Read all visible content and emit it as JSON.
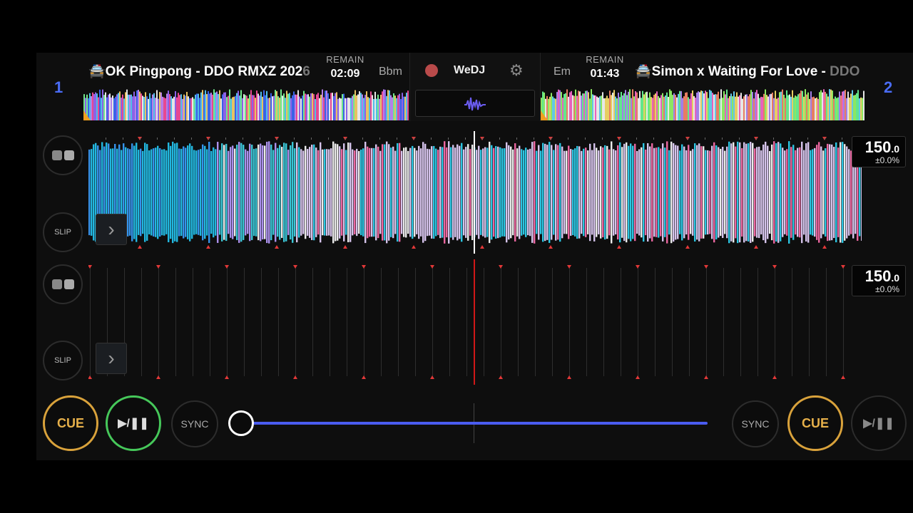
{
  "deck1": {
    "number": "1",
    "title_main": "OK Pingpong - DDO RMXZ 202",
    "title_fade": "6",
    "remain_label": "REMAIN",
    "remain_time": "02:09",
    "key": "Bbm",
    "bpm_int": "150",
    "bpm_dec": ".0",
    "pitch": "±0.0%",
    "slip_label": "SLIP",
    "cue_label": "CUE",
    "play_label": "▶/❚❚",
    "sync_label": "SYNC"
  },
  "deck2": {
    "number": "2",
    "title_main": "Simon x Waiting For Love - ",
    "title_fade": "DDO",
    "remain_label": "REMAIN",
    "remain_time": "01:43",
    "key": "Em",
    "bpm_int": "150",
    "bpm_dec": ".0",
    "pitch": "±0.0%",
    "slip_label": "SLIP",
    "cue_label": "CUE",
    "play_label": "▶/❚❚",
    "sync_label": "SYNC"
  },
  "center": {
    "logo": "WeDJ",
    "icons": [
      "record-icon",
      "gear-icon",
      "waveform-icon"
    ]
  },
  "crossfader": {
    "position": 0.0
  },
  "colors": {
    "deck_number": "#4a6cf5",
    "cue": "#d9a23b",
    "play_active": "#46c85a",
    "crossfader": "#4a5cf0",
    "playhead_deck1": "#ffffff",
    "playhead_deck2": "#d01818"
  }
}
